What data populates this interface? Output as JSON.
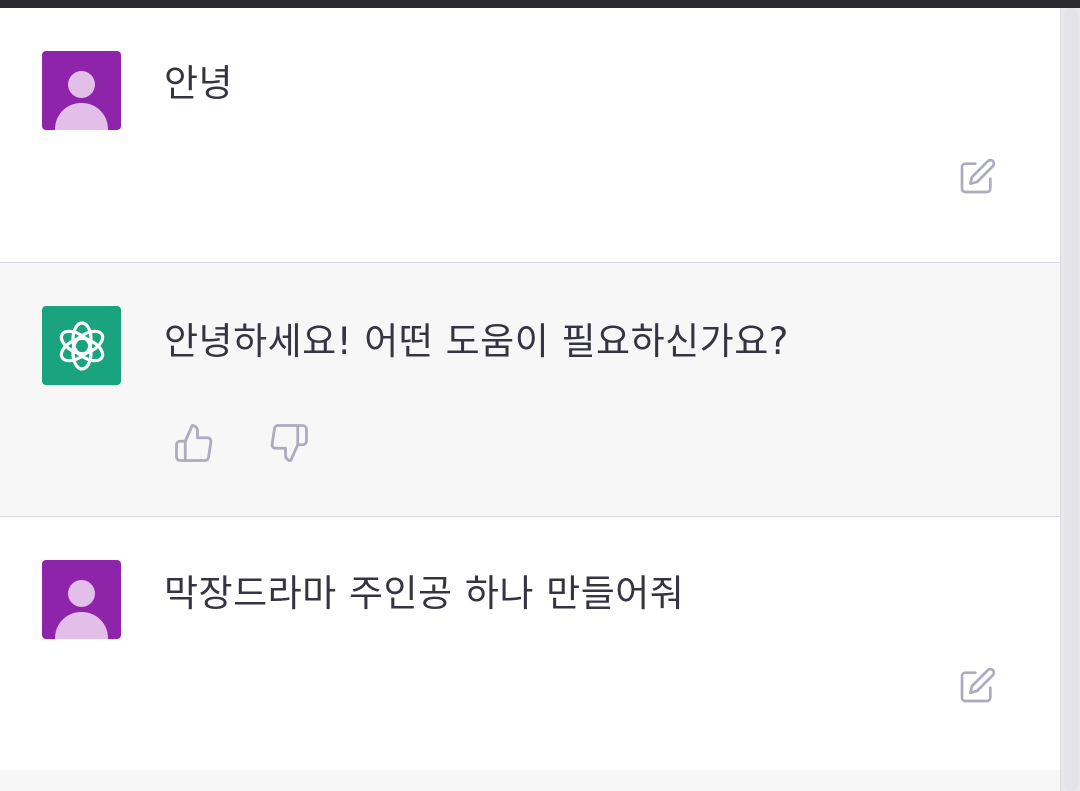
{
  "conversation": {
    "messages": [
      {
        "role": "user",
        "text": "안녕",
        "avatar_icon": "user-avatar-icon",
        "action_icon": "edit-icon"
      },
      {
        "role": "assistant",
        "text": "안녕하세요! 어떤 도움이 필요하신가요?",
        "avatar_icon": "openai-logo-icon",
        "action_icons": [
          "thumbs-up-icon",
          "thumbs-down-icon"
        ]
      },
      {
        "role": "user",
        "text": "막장드라마 주인공 하나 만들어줘",
        "avatar_icon": "user-avatar-icon",
        "action_icon": "edit-icon"
      }
    ]
  },
  "colors": {
    "user_avatar_bg": "#8e24aa",
    "assistant_avatar_bg": "#19a37f",
    "assistant_row_bg": "#f7f7f8",
    "icon_color": "#acacbe"
  }
}
